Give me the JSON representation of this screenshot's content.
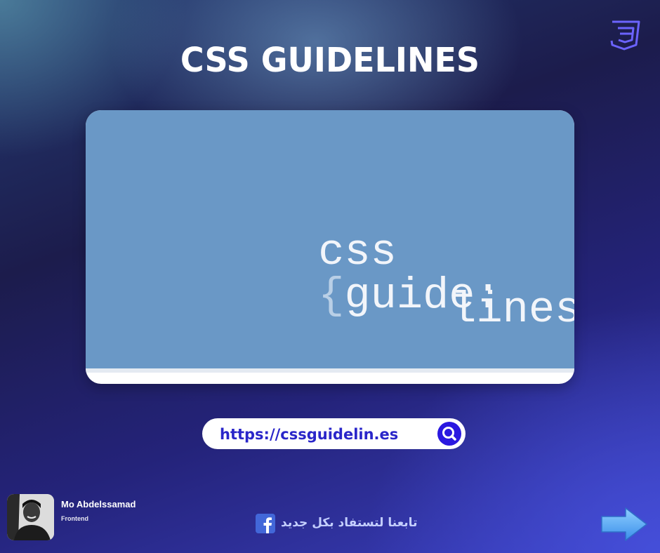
{
  "header": {
    "title": "CSS GUIDELINES",
    "corner_icon": "css3-logo-icon"
  },
  "image_card": {
    "logo_line1_word": "css",
    "logo_line1_brace": "{",
    "logo_line1_rest": "guide:",
    "logo_line2_word": "lines;",
    "logo_line2_brace": "}"
  },
  "url_bar": {
    "url": "https://cssguidelin.es",
    "icon": "search-icon"
  },
  "author": {
    "name": "Mo Abdelssamad",
    "role": "Frontend",
    "avatar_icon": "avatar"
  },
  "footer": {
    "follow_text": "تابعنا لتستفاد بكل جديد",
    "social_icon": "facebook-icon",
    "next_icon": "arrow-right-icon"
  },
  "colors": {
    "accent": "#2a18e0",
    "card_blue": "#6a98c6",
    "url_text": "#2a26c9"
  }
}
